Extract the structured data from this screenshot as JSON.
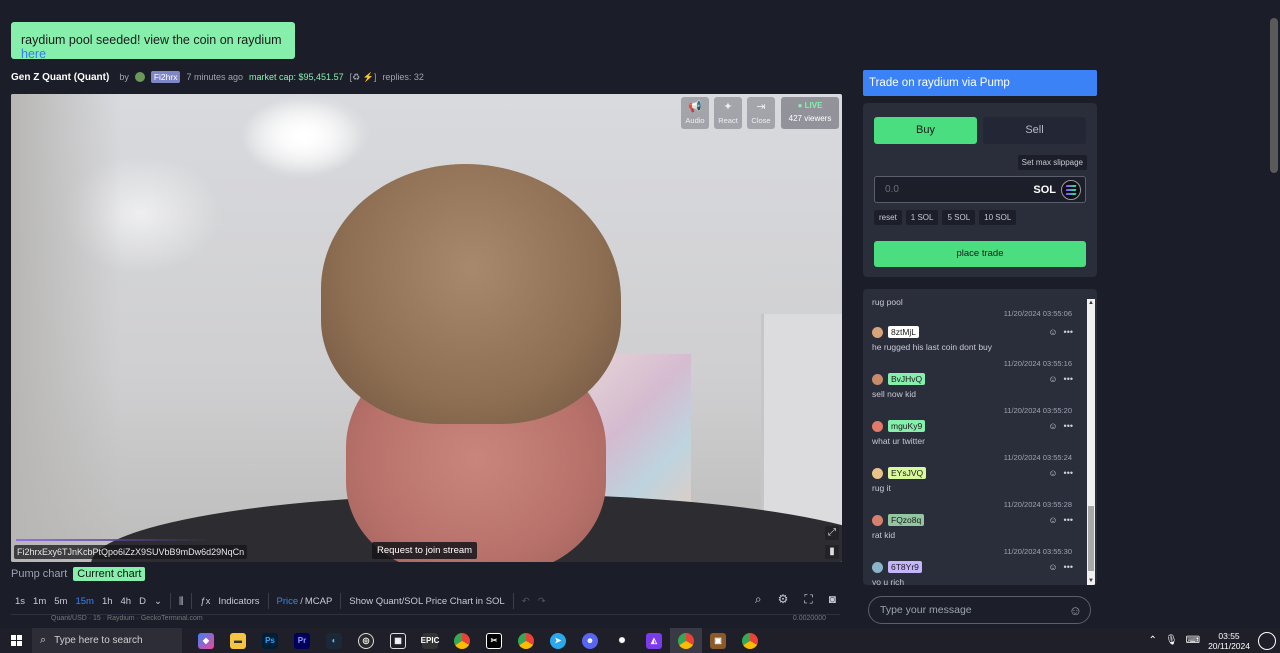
{
  "banner": {
    "text": "raydium pool seeded! view the coin on raydium ",
    "link": "here"
  },
  "coin": {
    "title": "Gen Z Quant (Quant)",
    "by_label": "by",
    "creator": "Fi2hrx",
    "age": "7 minutes ago",
    "market_cap": "market cap: $95,451.57",
    "badges": "[♻ ⚡]",
    "replies": "replies: 32"
  },
  "stream": {
    "controls": [
      {
        "label": "Audio",
        "icon": "megaphone-icon"
      },
      {
        "label": "React",
        "icon": "party-popper-icon"
      },
      {
        "label": "Close",
        "icon": "exit-icon"
      }
    ],
    "live_label": "● LIVE",
    "viewers": "427 viewers",
    "contract_address": "Fi2hrxExy6TJnKcbPtQpo6iZzX9SUVbB9mDw6d29NqCn",
    "join_button": "Request to join stream"
  },
  "chart_tabs": {
    "pump": "Pump chart",
    "current": "Current chart"
  },
  "toolbar": {
    "intervals": [
      "1s",
      "1m",
      "5m",
      "15m",
      "1h",
      "4h",
      "D"
    ],
    "active_interval": "15m",
    "indicators": "Indicators",
    "price": "Price",
    "slash": "/",
    "mcap": "MCAP",
    "show_label": "Show Quant/SOL Price Chart in SOL",
    "strip_text": "Quant/USD · 15 · Raydium · GeckoTerminal.com",
    "strip_value": "0.0020000"
  },
  "trade": {
    "header": "Trade on raydium via Pump",
    "buy": "Buy",
    "sell": "Sell",
    "slippage": "Set max slippage",
    "amount_placeholder": "0.0",
    "currency": "SOL",
    "quick": [
      "reset",
      "1 SOL",
      "5 SOL",
      "10 SOL"
    ],
    "place": "place trade"
  },
  "chat": {
    "first": {
      "text": "rug pool",
      "time": "11/20/2024 03:55:06"
    },
    "messages": [
      {
        "user": "8ztMjL",
        "color": "#ffffff",
        "text": "he rugged his last coin dont buy",
        "time": "11/20/2024 03:55:16"
      },
      {
        "user": "BvJHvQ",
        "color": "#86efac",
        "text": "sell now kid",
        "time": "11/20/2024 03:55:20"
      },
      {
        "user": "mguKy9",
        "color": "#86efac",
        "text": "what ur twitter",
        "time": "11/20/2024 03:55:24"
      },
      {
        "user": "EYsJVQ",
        "color": "#d9f99d",
        "text": "rug it",
        "time": "11/20/2024 03:55:28"
      },
      {
        "user": "FQzo8q",
        "color": "#93c5a0",
        "text": "rat kid",
        "time": "11/20/2024 03:55:30"
      },
      {
        "user": "6T8Yr9",
        "color": "#c4b5fd",
        "text": "yo u rich",
        "time": ""
      }
    ],
    "input_placeholder": "Type your message"
  },
  "taskbar": {
    "search_placeholder": "Type here to search",
    "time": "03:55",
    "date": "20/11/2024"
  },
  "colors": {
    "accent_green": "#4ade80",
    "accent_blue": "#3b82f6",
    "background": "#1b1d28",
    "panel": "#2a2d3a"
  }
}
